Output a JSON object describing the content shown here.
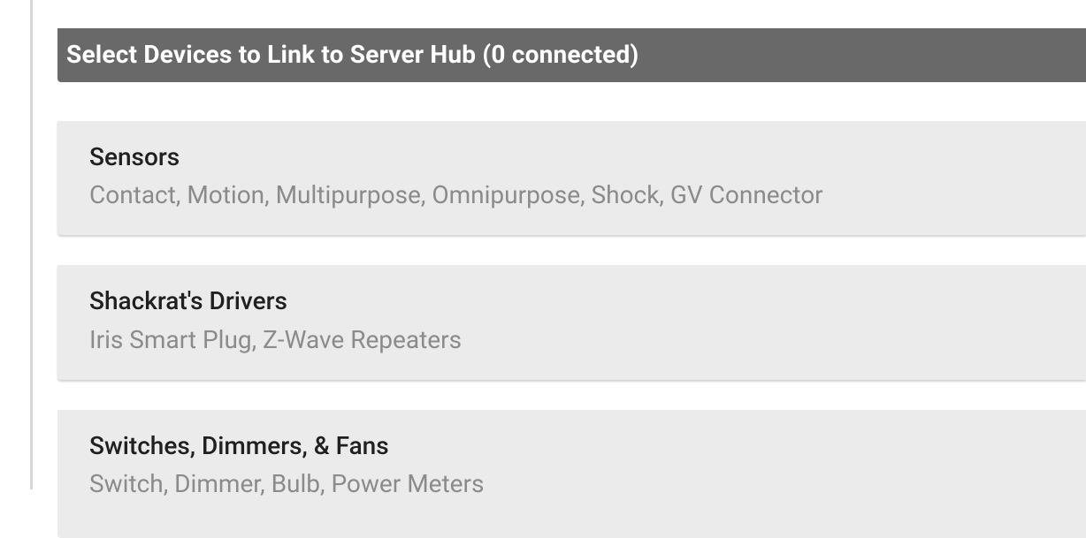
{
  "header": {
    "title": "Select Devices to Link to Server Hub  (0 connected)"
  },
  "categories": [
    {
      "title": "Sensors",
      "subtitle": "Contact, Motion, Multipurpose, Omnipurpose, Shock, GV Connector"
    },
    {
      "title": "Shackrat's Drivers",
      "subtitle": "Iris Smart Plug, Z-Wave Repeaters"
    },
    {
      "title": "Switches, Dimmers, & Fans",
      "subtitle": "Switch, Dimmer, Bulb, Power Meters"
    }
  ]
}
